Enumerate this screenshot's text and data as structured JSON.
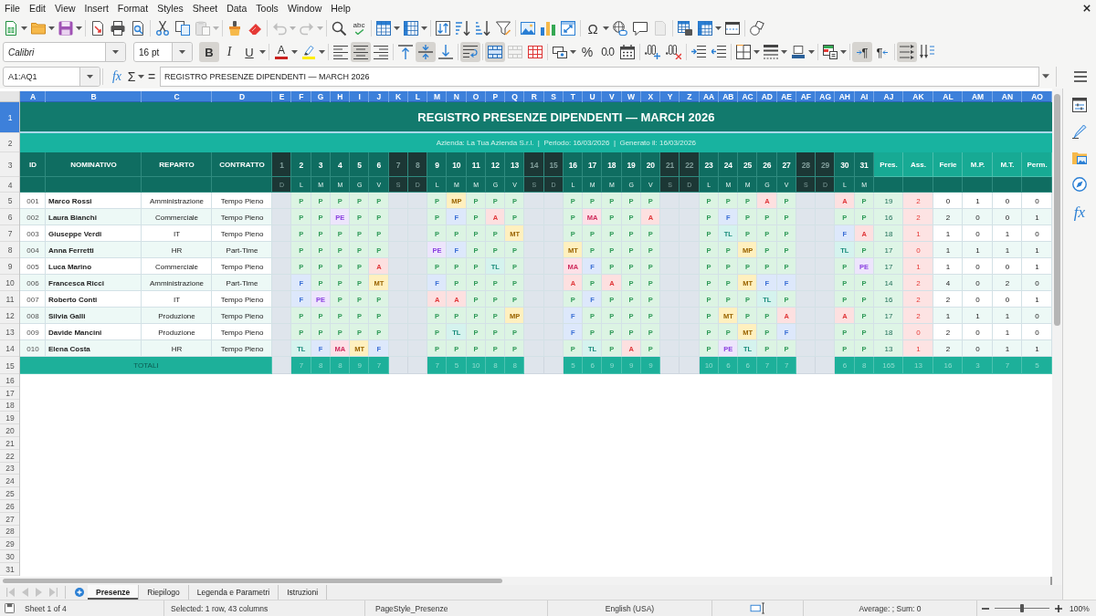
{
  "menu_bar": [
    "File",
    "Edit",
    "View",
    "Insert",
    "Format",
    "Styles",
    "Sheet",
    "Data",
    "Tools",
    "Window",
    "Help"
  ],
  "standard_toolbar": {
    "paste": {
      "disabled": true
    },
    "undo": {
      "disabled": true
    },
    "redo": {
      "disabled": true
    },
    "spelling": {
      "label": "abc"
    },
    "special_character": {
      "label": "Ω"
    },
    "header_footer": {
      "disabled": true
    }
  },
  "formatting_toolbar": {
    "font_name": "Calibri",
    "font_size": "16 pt",
    "bold": {
      "label": "B",
      "on": true
    },
    "italic": {
      "label": "I",
      "on": false
    },
    "underline": {
      "label": "U",
      "on": false
    },
    "font_color": {
      "label": "A",
      "color": "#c9211e"
    },
    "highlighting": {
      "color": "#ffee00"
    },
    "align_left": false,
    "align_center": true,
    "align_right": false,
    "align_top": false,
    "center_vertically": true,
    "align_bottom": false,
    "wrap_text": true,
    "merge_and_center": true,
    "merge_cells": {
      "disabled": true
    },
    "percent": {
      "label": "%"
    },
    "number": {
      "label": "0.0"
    },
    "border_color": {
      "color": "#2a6099"
    },
    "left_to_right": {
      "label": "¶",
      "on": true
    },
    "right_to_left": {
      "label": "¶",
      "on": false
    },
    "text_left_to_right": true,
    "text_top_to_bottom": false
  },
  "formula_bar": {
    "name_box": "A1:AQ1",
    "function_wizard": "fx",
    "sum": "Σ",
    "formula": "=",
    "content": "REGISTRO PRESENZE DIPENDENTI — MARCH 2026"
  },
  "sheet": {
    "column_headers": [
      {
        "label": "A",
        "selected": true
      },
      {
        "label": "B",
        "selected": true
      },
      {
        "label": "C",
        "selected": true
      },
      {
        "label": "D",
        "selected": true
      },
      {
        "label": "E",
        "selected": true
      },
      {
        "label": "F",
        "selected": true
      },
      {
        "label": "G",
        "selected": true
      },
      {
        "label": "H",
        "selected": true
      },
      {
        "label": "I",
        "selected": true
      },
      {
        "label": "J",
        "selected": true
      },
      {
        "label": "K",
        "selected": true
      },
      {
        "label": "L",
        "selected": true
      },
      {
        "label": "M",
        "selected": true
      },
      {
        "label": "N",
        "selected": true
      },
      {
        "label": "O",
        "selected": true
      },
      {
        "label": "P",
        "selected": true
      },
      {
        "label": "Q",
        "selected": true
      },
      {
        "label": "R",
        "selected": true
      },
      {
        "label": "S",
        "selected": true
      },
      {
        "label": "T",
        "selected": true
      },
      {
        "label": "U",
        "selected": true
      },
      {
        "label": "V",
        "selected": true
      },
      {
        "label": "W",
        "selected": true
      },
      {
        "label": "X",
        "selected": true
      },
      {
        "label": "Y",
        "selected": true
      },
      {
        "label": "Z",
        "selected": true
      },
      {
        "label": "AA",
        "selected": true
      },
      {
        "label": "AB",
        "selected": true
      },
      {
        "label": "AC",
        "selected": true
      },
      {
        "label": "AD",
        "selected": true
      },
      {
        "label": "AE",
        "selected": true
      },
      {
        "label": "AF",
        "selected": true
      },
      {
        "label": "AG",
        "selected": true
      },
      {
        "label": "AH",
        "selected": true
      },
      {
        "label": "AI",
        "selected": true
      },
      {
        "label": "AJ",
        "selected": true
      },
      {
        "label": "AK",
        "selected": true
      },
      {
        "label": "AL",
        "selected": true
      },
      {
        "label": "AM",
        "selected": true
      },
      {
        "label": "AN",
        "selected": true
      },
      {
        "label": "AO",
        "selected": true
      }
    ],
    "row_headers": [
      {
        "label": "1",
        "selected": true
      },
      {
        "label": "2",
        "selected": false
      },
      {
        "label": "3",
        "selected": false
      },
      {
        "label": "4",
        "selected": false
      },
      {
        "label": "5",
        "selected": false
      },
      {
        "label": "6",
        "selected": false
      },
      {
        "label": "7",
        "selected": false
      },
      {
        "label": "8",
        "selected": false
      },
      {
        "label": "9",
        "selected": false
      },
      {
        "label": "10",
        "selected": false
      },
      {
        "label": "11",
        "selected": false
      },
      {
        "label": "12",
        "selected": false
      },
      {
        "label": "13",
        "selected": false
      },
      {
        "label": "14",
        "selected": false
      },
      {
        "label": "15",
        "selected": false
      },
      {
        "label": "16",
        "selected": false
      },
      {
        "label": "17",
        "selected": false
      },
      {
        "label": "18",
        "selected": false
      },
      {
        "label": "19",
        "selected": false
      },
      {
        "label": "20",
        "selected": false
      },
      {
        "label": "21",
        "selected": false
      },
      {
        "label": "22",
        "selected": false
      },
      {
        "label": "23",
        "selected": false
      },
      {
        "label": "24",
        "selected": false
      },
      {
        "label": "25",
        "selected": false
      },
      {
        "label": "26",
        "selected": false
      },
      {
        "label": "27",
        "selected": false
      },
      {
        "label": "28",
        "selected": false
      },
      {
        "label": "29",
        "selected": false
      },
      {
        "label": "30",
        "selected": false
      },
      {
        "label": "31",
        "selected": false
      }
    ],
    "title": "REGISTRO PRESENZE DIPENDENTI — MARCH 2026",
    "subtitle": "Azienda: La Tua Azienda S.r.l.  |  Periodo: 16/03/2026  |  Generato il: 16/03/2026",
    "header_columns": [
      "ID",
      "NOMINATIVO",
      "REPARTO",
      "CONTRATTO"
    ],
    "days": [
      {
        "day": "1",
        "weekday": "D",
        "weekend": true
      },
      {
        "day": "2",
        "weekday": "L",
        "weekend": false
      },
      {
        "day": "3",
        "weekday": "M",
        "weekend": false
      },
      {
        "day": "4",
        "weekday": "M",
        "weekend": false
      },
      {
        "day": "5",
        "weekday": "G",
        "weekend": false
      },
      {
        "day": "6",
        "weekday": "V",
        "weekend": false
      },
      {
        "day": "7",
        "weekday": "S",
        "weekend": true
      },
      {
        "day": "8",
        "weekday": "D",
        "weekend": true
      },
      {
        "day": "9",
        "weekday": "L",
        "weekend": false
      },
      {
        "day": "10",
        "weekday": "M",
        "weekend": false
      },
      {
        "day": "11",
        "weekday": "M",
        "weekend": false
      },
      {
        "day": "12",
        "weekday": "G",
        "weekend": false
      },
      {
        "day": "13",
        "weekday": "V",
        "weekend": false
      },
      {
        "day": "14",
        "weekday": "S",
        "weekend": true
      },
      {
        "day": "15",
        "weekday": "D",
        "weekend": true
      },
      {
        "day": "16",
        "weekday": "L",
        "weekend": false
      },
      {
        "day": "17",
        "weekday": "M",
        "weekend": false
      },
      {
        "day": "18",
        "weekday": "M",
        "weekend": false
      },
      {
        "day": "19",
        "weekday": "G",
        "weekend": false
      },
      {
        "day": "20",
        "weekday": "V",
        "weekend": false
      },
      {
        "day": "21",
        "weekday": "S",
        "weekend": true
      },
      {
        "day": "22",
        "weekday": "D",
        "weekend": true
      },
      {
        "day": "23",
        "weekday": "L",
        "weekend": false
      },
      {
        "day": "24",
        "weekday": "M",
        "weekend": false
      },
      {
        "day": "25",
        "weekday": "M",
        "weekend": false
      },
      {
        "day": "26",
        "weekday": "G",
        "weekend": false
      },
      {
        "day": "27",
        "weekday": "V",
        "weekend": false
      },
      {
        "day": "28",
        "weekday": "S",
        "weekend": true
      },
      {
        "day": "29",
        "weekday": "D",
        "weekend": true
      },
      {
        "day": "30",
        "weekday": "L",
        "weekend": false
      },
      {
        "day": "31",
        "weekday": "M",
        "weekend": false
      }
    ],
    "summary_columns": [
      {
        "label": "Pres.",
        "kind": "present"
      },
      {
        "label": "Ass.",
        "kind": "absent"
      },
      {
        "label": "Ferie",
        "kind": "count"
      },
      {
        "label": "M.P.",
        "kind": "count"
      },
      {
        "label": "M.T.",
        "kind": "count"
      },
      {
        "label": "Perm.",
        "kind": "count"
      }
    ],
    "employees": [
      {
        "id": "001",
        "name": "Marco Rossi",
        "department": "Amministrazione",
        "contract": "Tempo Pieno",
        "days": [
          {
            "code": "P",
            "kind": "present"
          },
          {
            "code": "P",
            "kind": "present"
          },
          {
            "code": "P",
            "kind": "present"
          },
          {
            "code": "P",
            "kind": "present"
          },
          {
            "code": "P",
            "kind": "present"
          },
          {
            "code": "P",
            "kind": "present"
          },
          {
            "code": "MP",
            "kind": "partial"
          },
          {
            "code": "P",
            "kind": "present"
          },
          {
            "code": "P",
            "kind": "present"
          },
          {
            "code": "P",
            "kind": "present"
          },
          {
            "code": "P",
            "kind": "present"
          },
          {
            "code": "P",
            "kind": "present"
          },
          {
            "code": "P",
            "kind": "present"
          },
          {
            "code": "P",
            "kind": "present"
          },
          {
            "code": "P",
            "kind": "present"
          },
          {
            "code": "P",
            "kind": "present"
          },
          {
            "code": "P",
            "kind": "present"
          },
          {
            "code": "P",
            "kind": "present"
          },
          {
            "code": "A",
            "kind": "absent"
          },
          {
            "code": "P",
            "kind": "present"
          },
          {
            "code": "A",
            "kind": "absent"
          },
          {
            "code": "P",
            "kind": "present"
          }
        ],
        "summary": [
          "19",
          "2",
          "0",
          "1",
          "0",
          "0"
        ]
      },
      {
        "id": "002",
        "name": "Laura Bianchi",
        "department": "Commerciale",
        "contract": "Tempo Pieno",
        "days": [
          {
            "code": "P",
            "kind": "present"
          },
          {
            "code": "P",
            "kind": "present"
          },
          {
            "code": "PE",
            "kind": "permit"
          },
          {
            "code": "P",
            "kind": "present"
          },
          {
            "code": "P",
            "kind": "present"
          },
          {
            "code": "P",
            "kind": "present"
          },
          {
            "code": "F",
            "kind": "holiday"
          },
          {
            "code": "P",
            "kind": "present"
          },
          {
            "code": "A",
            "kind": "absent"
          },
          {
            "code": "P",
            "kind": "present"
          },
          {
            "code": "P",
            "kind": "present"
          },
          {
            "code": "MA",
            "kind": "sick"
          },
          {
            "code": "P",
            "kind": "present"
          },
          {
            "code": "P",
            "kind": "present"
          },
          {
            "code": "A",
            "kind": "absent"
          },
          {
            "code": "P",
            "kind": "present"
          },
          {
            "code": "F",
            "kind": "holiday"
          },
          {
            "code": "P",
            "kind": "present"
          },
          {
            "code": "P",
            "kind": "present"
          },
          {
            "code": "P",
            "kind": "present"
          },
          {
            "code": "P",
            "kind": "present"
          },
          {
            "code": "P",
            "kind": "present"
          }
        ],
        "summary": [
          "16",
          "2",
          "2",
          "0",
          "0",
          "1"
        ]
      },
      {
        "id": "003",
        "name": "Giuseppe Verdi",
        "department": "IT",
        "contract": "Tempo Pieno",
        "days": [
          {
            "code": "P",
            "kind": "present"
          },
          {
            "code": "P",
            "kind": "present"
          },
          {
            "code": "P",
            "kind": "present"
          },
          {
            "code": "P",
            "kind": "present"
          },
          {
            "code": "P",
            "kind": "present"
          },
          {
            "code": "P",
            "kind": "present"
          },
          {
            "code": "P",
            "kind": "present"
          },
          {
            "code": "P",
            "kind": "present"
          },
          {
            "code": "P",
            "kind": "present"
          },
          {
            "code": "MT",
            "kind": "partial"
          },
          {
            "code": "P",
            "kind": "present"
          },
          {
            "code": "P",
            "kind": "present"
          },
          {
            "code": "P",
            "kind": "present"
          },
          {
            "code": "P",
            "kind": "present"
          },
          {
            "code": "P",
            "kind": "present"
          },
          {
            "code": "P",
            "kind": "present"
          },
          {
            "code": "TL",
            "kind": "remote"
          },
          {
            "code": "P",
            "kind": "present"
          },
          {
            "code": "P",
            "kind": "present"
          },
          {
            "code": "P",
            "kind": "present"
          },
          {
            "code": "F",
            "kind": "holiday"
          },
          {
            "code": "A",
            "kind": "absent"
          }
        ],
        "summary": [
          "18",
          "1",
          "1",
          "0",
          "1",
          "0"
        ]
      },
      {
        "id": "004",
        "name": "Anna Ferretti",
        "department": "HR",
        "contract": "Part-Time",
        "days": [
          {
            "code": "P",
            "kind": "present"
          },
          {
            "code": "P",
            "kind": "present"
          },
          {
            "code": "P",
            "kind": "present"
          },
          {
            "code": "P",
            "kind": "present"
          },
          {
            "code": "P",
            "kind": "present"
          },
          {
            "code": "PE",
            "kind": "permit"
          },
          {
            "code": "F",
            "kind": "holiday"
          },
          {
            "code": "P",
            "kind": "present"
          },
          {
            "code": "P",
            "kind": "present"
          },
          {
            "code": "P",
            "kind": "present"
          },
          {
            "code": "MT",
            "kind": "partial"
          },
          {
            "code": "P",
            "kind": "present"
          },
          {
            "code": "P",
            "kind": "present"
          },
          {
            "code": "P",
            "kind": "present"
          },
          {
            "code": "P",
            "kind": "present"
          },
          {
            "code": "P",
            "kind": "present"
          },
          {
            "code": "P",
            "kind": "present"
          },
          {
            "code": "MP",
            "kind": "partial"
          },
          {
            "code": "P",
            "kind": "present"
          },
          {
            "code": "P",
            "kind": "present"
          },
          {
            "code": "TL",
            "kind": "remote"
          },
          {
            "code": "P",
            "kind": "present"
          }
        ],
        "summary": [
          "17",
          "0",
          "1",
          "1",
          "1",
          "1"
        ]
      },
      {
        "id": "005",
        "name": "Luca Marino",
        "department": "Commerciale",
        "contract": "Tempo Pieno",
        "days": [
          {
            "code": "P",
            "kind": "present"
          },
          {
            "code": "P",
            "kind": "present"
          },
          {
            "code": "P",
            "kind": "present"
          },
          {
            "code": "P",
            "kind": "present"
          },
          {
            "code": "A",
            "kind": "absent"
          },
          {
            "code": "P",
            "kind": "present"
          },
          {
            "code": "P",
            "kind": "present"
          },
          {
            "code": "P",
            "kind": "present"
          },
          {
            "code": "TL",
            "kind": "remote"
          },
          {
            "code": "P",
            "kind": "present"
          },
          {
            "code": "MA",
            "kind": "sick"
          },
          {
            "code": "F",
            "kind": "holiday"
          },
          {
            "code": "P",
            "kind": "present"
          },
          {
            "code": "P",
            "kind": "present"
          },
          {
            "code": "P",
            "kind": "present"
          },
          {
            "code": "P",
            "kind": "present"
          },
          {
            "code": "P",
            "kind": "present"
          },
          {
            "code": "P",
            "kind": "present"
          },
          {
            "code": "P",
            "kind": "present"
          },
          {
            "code": "P",
            "kind": "present"
          },
          {
            "code": "P",
            "kind": "present"
          },
          {
            "code": "PE",
            "kind": "permit"
          }
        ],
        "summary": [
          "17",
          "1",
          "1",
          "0",
          "0",
          "1"
        ]
      },
      {
        "id": "006",
        "name": "Francesca Ricci",
        "department": "Amministrazione",
        "contract": "Part-Time",
        "days": [
          {
            "code": "F",
            "kind": "holiday"
          },
          {
            "code": "P",
            "kind": "present"
          },
          {
            "code": "P",
            "kind": "present"
          },
          {
            "code": "P",
            "kind": "present"
          },
          {
            "code": "MT",
            "kind": "partial"
          },
          {
            "code": "F",
            "kind": "holiday"
          },
          {
            "code": "P",
            "kind": "present"
          },
          {
            "code": "P",
            "kind": "present"
          },
          {
            "code": "P",
            "kind": "present"
          },
          {
            "code": "P",
            "kind": "present"
          },
          {
            "code": "A",
            "kind": "absent"
          },
          {
            "code": "P",
            "kind": "present"
          },
          {
            "code": "A",
            "kind": "absent"
          },
          {
            "code": "P",
            "kind": "present"
          },
          {
            "code": "P",
            "kind": "present"
          },
          {
            "code": "P",
            "kind": "present"
          },
          {
            "code": "P",
            "kind": "present"
          },
          {
            "code": "MT",
            "kind": "partial"
          },
          {
            "code": "F",
            "kind": "holiday"
          },
          {
            "code": "F",
            "kind": "holiday"
          },
          {
            "code": "P",
            "kind": "present"
          },
          {
            "code": "P",
            "kind": "present"
          }
        ],
        "summary": [
          "14",
          "2",
          "4",
          "0",
          "2",
          "0"
        ]
      },
      {
        "id": "007",
        "name": "Roberto Conti",
        "department": "IT",
        "contract": "Tempo Pieno",
        "days": [
          {
            "code": "F",
            "kind": "holiday"
          },
          {
            "code": "PE",
            "kind": "permit"
          },
          {
            "code": "P",
            "kind": "present"
          },
          {
            "code": "P",
            "kind": "present"
          },
          {
            "code": "P",
            "kind": "present"
          },
          {
            "code": "A",
            "kind": "absent"
          },
          {
            "code": "A",
            "kind": "absent"
          },
          {
            "code": "P",
            "kind": "present"
          },
          {
            "code": "P",
            "kind": "present"
          },
          {
            "code": "P",
            "kind": "present"
          },
          {
            "code": "P",
            "kind": "present"
          },
          {
            "code": "F",
            "kind": "holiday"
          },
          {
            "code": "P",
            "kind": "present"
          },
          {
            "code": "P",
            "kind": "present"
          },
          {
            "code": "P",
            "kind": "present"
          },
          {
            "code": "P",
            "kind": "present"
          },
          {
            "code": "P",
            "kind": "present"
          },
          {
            "code": "P",
            "kind": "present"
          },
          {
            "code": "TL",
            "kind": "remote"
          },
          {
            "code": "P",
            "kind": "present"
          },
          {
            "code": "P",
            "kind": "present"
          },
          {
            "code": "P",
            "kind": "present"
          }
        ],
        "summary": [
          "16",
          "2",
          "2",
          "0",
          "0",
          "1"
        ]
      },
      {
        "id": "008",
        "name": "Silvia Galli",
        "department": "Produzione",
        "contract": "Tempo Pieno",
        "days": [
          {
            "code": "P",
            "kind": "present"
          },
          {
            "code": "P",
            "kind": "present"
          },
          {
            "code": "P",
            "kind": "present"
          },
          {
            "code": "P",
            "kind": "present"
          },
          {
            "code": "P",
            "kind": "present"
          },
          {
            "code": "P",
            "kind": "present"
          },
          {
            "code": "P",
            "kind": "present"
          },
          {
            "code": "P",
            "kind": "present"
          },
          {
            "code": "P",
            "kind": "present"
          },
          {
            "code": "MP",
            "kind": "partial"
          },
          {
            "code": "F",
            "kind": "holiday"
          },
          {
            "code": "P",
            "kind": "present"
          },
          {
            "code": "P",
            "kind": "present"
          },
          {
            "code": "P",
            "kind": "present"
          },
          {
            "code": "P",
            "kind": "present"
          },
          {
            "code": "P",
            "kind": "present"
          },
          {
            "code": "MT",
            "kind": "partial"
          },
          {
            "code": "P",
            "kind": "present"
          },
          {
            "code": "P",
            "kind": "present"
          },
          {
            "code": "A",
            "kind": "absent"
          },
          {
            "code": "A",
            "kind": "absent"
          },
          {
            "code": "P",
            "kind": "present"
          }
        ],
        "summary": [
          "17",
          "2",
          "1",
          "1",
          "1",
          "0"
        ]
      },
      {
        "id": "009",
        "name": "Davide Mancini",
        "department": "Produzione",
        "contract": "Tempo Pieno",
        "days": [
          {
            "code": "P",
            "kind": "present"
          },
          {
            "code": "P",
            "kind": "present"
          },
          {
            "code": "P",
            "kind": "present"
          },
          {
            "code": "P",
            "kind": "present"
          },
          {
            "code": "P",
            "kind": "present"
          },
          {
            "code": "P",
            "kind": "present"
          },
          {
            "code": "TL",
            "kind": "remote"
          },
          {
            "code": "P",
            "kind": "present"
          },
          {
            "code": "P",
            "kind": "present"
          },
          {
            "code": "P",
            "kind": "present"
          },
          {
            "code": "F",
            "kind": "holiday"
          },
          {
            "code": "P",
            "kind": "present"
          },
          {
            "code": "P",
            "kind": "present"
          },
          {
            "code": "P",
            "kind": "present"
          },
          {
            "code": "P",
            "kind": "present"
          },
          {
            "code": "P",
            "kind": "present"
          },
          {
            "code": "P",
            "kind": "present"
          },
          {
            "code": "MT",
            "kind": "partial"
          },
          {
            "code": "P",
            "kind": "present"
          },
          {
            "code": "F",
            "kind": "holiday"
          },
          {
            "code": "P",
            "kind": "present"
          },
          {
            "code": "P",
            "kind": "present"
          }
        ],
        "summary": [
          "18",
          "0",
          "2",
          "0",
          "1",
          "0"
        ]
      },
      {
        "id": "010",
        "name": "Elena Costa",
        "department": "HR",
        "contract": "Tempo Pieno",
        "days": [
          {
            "code": "TL",
            "kind": "remote"
          },
          {
            "code": "F",
            "kind": "holiday"
          },
          {
            "code": "MA",
            "kind": "sick"
          },
          {
            "code": "MT",
            "kind": "partial"
          },
          {
            "code": "F",
            "kind": "holiday"
          },
          {
            "code": "P",
            "kind": "present"
          },
          {
            "code": "P",
            "kind": "present"
          },
          {
            "code": "P",
            "kind": "present"
          },
          {
            "code": "P",
            "kind": "present"
          },
          {
            "code": "P",
            "kind": "present"
          },
          {
            "code": "P",
            "kind": "present"
          },
          {
            "code": "TL",
            "kind": "remote"
          },
          {
            "code": "P",
            "kind": "present"
          },
          {
            "code": "A",
            "kind": "absent"
          },
          {
            "code": "P",
            "kind": "present"
          },
          {
            "code": "P",
            "kind": "present"
          },
          {
            "code": "PE",
            "kind": "permit"
          },
          {
            "code": "TL",
            "kind": "remote"
          },
          {
            "code": "P",
            "kind": "present"
          },
          {
            "code": "P",
            "kind": "present"
          },
          {
            "code": "P",
            "kind": "present"
          },
          {
            "code": "P",
            "kind": "present"
          }
        ],
        "summary": [
          "13",
          "1",
          "2",
          "0",
          "1",
          "1"
        ]
      }
    ],
    "totals": {
      "label": "TOTALI",
      "days": [
        "7",
        "8",
        "8",
        "9",
        "7",
        "7",
        "5",
        "10",
        "8",
        "8",
        "5",
        "6",
        "9",
        "9",
        "9",
        "10",
        "6",
        "6",
        "7",
        "7",
        "6",
        "8"
      ],
      "summary": [
        "165",
        "13",
        "16",
        "3",
        "7",
        "5"
      ]
    }
  },
  "sheet_tabs": {
    "navigation_disabled": true,
    "tabs": [
      {
        "label": "Presenze",
        "selected": true
      },
      {
        "label": "Riepilogo",
        "selected": false
      },
      {
        "label": "Legenda e Parametri",
        "selected": false
      },
      {
        "label": "Istruzioni",
        "selected": false
      }
    ]
  },
  "sidebar": {
    "functions": "fx"
  },
  "status_bar": {
    "sheet": "Sheet 1 of 4",
    "selection": "Selected: 1 row, 43 columns",
    "page_style": "PageStyle_Presenze",
    "language": "English (USA)",
    "statistics": "Average: ; Sum: 0",
    "zoom_slider": {
      "level": 0.5
    },
    "zoom": "100%"
  }
}
